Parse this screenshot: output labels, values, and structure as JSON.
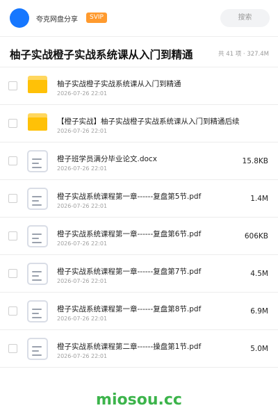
{
  "header": {
    "site_name": "夸克网盘分享",
    "badge": "SVIP",
    "search_placeholder": "搜索"
  },
  "folder": {
    "title": "柚子实战橙子实战系统课从入门到精通",
    "stats": "共 41 项 · 327.4M"
  },
  "files": [
    {
      "type": "folder",
      "name": "柚子实战橙子实战系统课从入门到精通",
      "date": "2026-07-26 22:01",
      "size": ""
    },
    {
      "type": "folder",
      "name": "【橙子实战】柚子实战橙子实战系统课从入门到精通后续",
      "date": "2026-07-26 22:01",
      "size": ""
    },
    {
      "type": "doc",
      "name": "橙子班学员满分毕业论文.docx",
      "date": "2026-07-26 22:01",
      "size": "15.8KB"
    },
    {
      "type": "doc",
      "name": "橙子实战系统课程第一章------复盘第5节.pdf",
      "date": "2026-07-26 22:01",
      "size": "1.4M"
    },
    {
      "type": "doc",
      "name": "橙子实战系统课程第一章------复盘第6节.pdf",
      "date": "2026-07-26 22:01",
      "size": "606KB"
    },
    {
      "type": "doc",
      "name": "橙子实战系统课程第一章------复盘第7节.pdf",
      "date": "2026-07-26 22:01",
      "size": "4.5M"
    },
    {
      "type": "doc",
      "name": "橙子实战系统课程第一章------复盘第8节.pdf",
      "date": "2026-07-26 22:01",
      "size": "6.9M"
    },
    {
      "type": "doc",
      "name": "橙子实战系统课程第二章------操盘第1节.pdf",
      "date": "2026-07-26 22:01",
      "size": "5.0M"
    }
  ],
  "watermark": "miosou.cc",
  "colors": {
    "avatar": "#1677ff",
    "svip_badge": "#ff9a2e",
    "folder_icon": "#ffc107",
    "watermark": "#3cb44b"
  }
}
